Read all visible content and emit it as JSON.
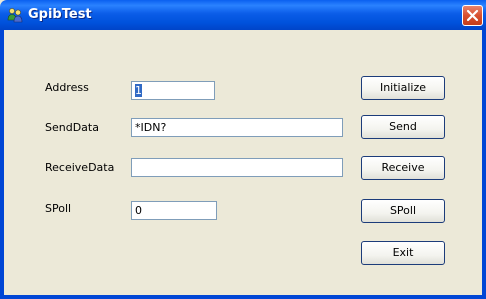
{
  "window": {
    "title": "GpibTest"
  },
  "form": {
    "address_label": "Address",
    "address_value": "1",
    "senddata_label": "SendData",
    "senddata_value": "*IDN?",
    "receivedata_label": "ReceiveData",
    "receivedata_value": "",
    "spoll_label": "SPoll",
    "spoll_value": "0"
  },
  "buttons": {
    "initialize": "Initialize",
    "send": "Send",
    "receive": "Receive",
    "spoll": "SPoll",
    "exit": "Exit"
  },
  "colors": {
    "title_bar": "#0052dc",
    "window_bg": "#ece9d8",
    "close_button": "#d8502f"
  },
  "icons": {
    "app": "people-icon",
    "close": "close-icon"
  }
}
